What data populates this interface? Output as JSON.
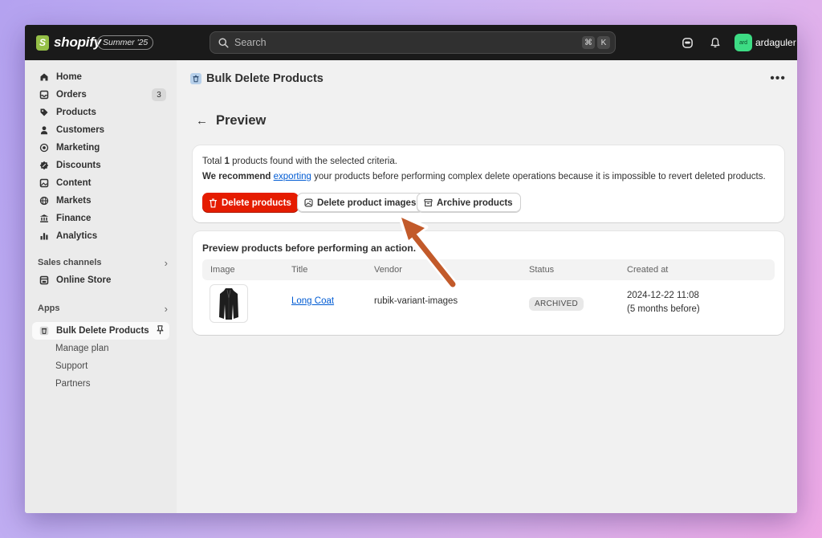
{
  "topbar": {
    "logo_text": "shopify",
    "edition": "Summer '25",
    "search_placeholder": "Search",
    "shortcut_keys": [
      "⌘",
      "K"
    ],
    "avatar_initials": "ard",
    "username": "ardaguler"
  },
  "sidebar": {
    "items": [
      {
        "label": "Home",
        "icon": "home-icon"
      },
      {
        "label": "Orders",
        "icon": "orders-icon",
        "count": "3"
      },
      {
        "label": "Products",
        "icon": "tag-icon"
      },
      {
        "label": "Customers",
        "icon": "person-icon"
      },
      {
        "label": "Marketing",
        "icon": "target-icon"
      },
      {
        "label": "Discounts",
        "icon": "discount-icon"
      },
      {
        "label": "Content",
        "icon": "image-icon"
      },
      {
        "label": "Markets",
        "icon": "globe-icon"
      },
      {
        "label": "Finance",
        "icon": "bank-icon"
      },
      {
        "label": "Analytics",
        "icon": "bar-chart-icon"
      }
    ],
    "sales_channels_label": "Sales channels",
    "online_store_label": "Online Store",
    "apps_label": "Apps",
    "app_active_label": "Bulk Delete Products",
    "app_sub_items": [
      "Manage plan",
      "Support",
      "Partners"
    ]
  },
  "main": {
    "app_title": "Bulk Delete Products",
    "page_title": "Preview",
    "summary": {
      "prefix": "Total ",
      "count": "1",
      "suffix": " products found with the selected criteria."
    },
    "recommend": {
      "strong": "We recommend",
      "link": "exporting",
      "rest": " your products before performing complex delete operations because it is impossible to revert deleted products."
    },
    "buttons": {
      "delete_products": "Delete products",
      "delete_images": "Delete product images",
      "archive": "Archive products"
    },
    "preview_title": "Preview products before performing an action.",
    "table": {
      "columns": [
        "Image",
        "Title",
        "Vendor",
        "Status",
        "Created at"
      ],
      "rows": [
        {
          "title": "Long Coat",
          "vendor": "rubik-variant-images",
          "status": "ARCHIVED",
          "created": "2024-12-22 11:08",
          "created_relative": "(5 months before)"
        }
      ]
    }
  },
  "colors": {
    "topbar": "#1a1a1a",
    "danger": "#e51c00",
    "link": "#005bd3",
    "annotation_arrow": "#c25a2a",
    "avatar": "#3ddc84"
  }
}
